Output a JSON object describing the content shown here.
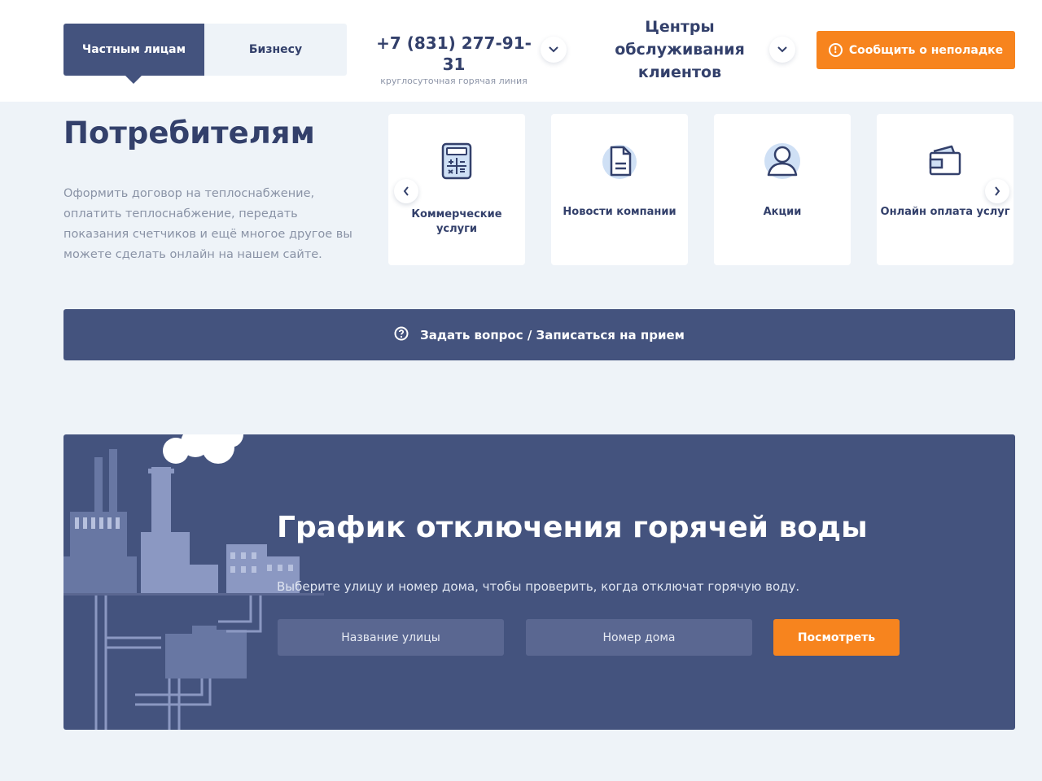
{
  "header": {
    "segment": {
      "private": "Частным лицам",
      "business": "Бизнесу"
    },
    "phone": {
      "number": "+7 (831) 277-91-31",
      "subtitle": "круглосуточная горячая линия"
    },
    "service_centers": "Центры обслуживания клиентов",
    "report_button": "Сообщить о неполадке"
  },
  "main": {
    "title": "Потребителям",
    "description": "Оформить договор на теплоснабжение, оплатить теплоснабжение, передать показания счетчиков и ещё многое другое вы можете сделать онлайн на нашем сайте.",
    "cards": [
      {
        "label": "Коммерческие услуги",
        "icon": "calculator-icon"
      },
      {
        "label": "Новости компании",
        "icon": "document-icon"
      },
      {
        "label": "Акции",
        "icon": "user-icon"
      },
      {
        "label": "Онлайн оплата услуг",
        "icon": "wallet-icon"
      }
    ],
    "ask_button": "Задать вопрос / Записаться на прием"
  },
  "banner": {
    "title": "График отключения горячей воды",
    "description": "Выберите улицу и номер дома, чтобы проверить, когда отключат горячую воду.",
    "street_placeholder": "Название улицы",
    "house_placeholder": "Номер дома",
    "submit": "Посмотреть"
  },
  "colors": {
    "primary": "#44537e",
    "accent": "#f7841e",
    "background": "#eef3f8",
    "text": "#33406b"
  }
}
